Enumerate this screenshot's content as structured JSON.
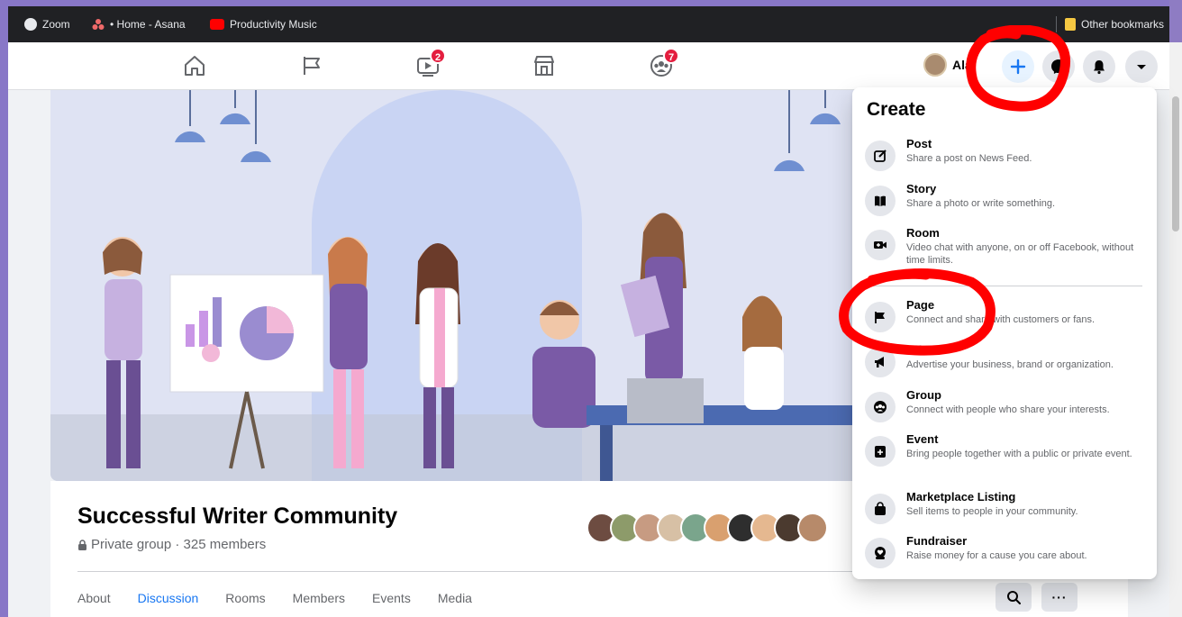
{
  "bookmarks": {
    "items": [
      {
        "label": "Zoom",
        "icon": "globe-icon"
      },
      {
        "label": "• Home - Asana",
        "icon": "asana-icon"
      },
      {
        "label": "Productivity Music",
        "icon": "youtube-icon"
      }
    ],
    "other": "Other bookmarks"
  },
  "nav": {
    "watch_badge": "2",
    "groups_badge": "7",
    "profile_name": "Ala",
    "colors": {
      "accent": "#1877f2",
      "badge": "#e41e3f"
    }
  },
  "group": {
    "name": "Successful Writer Community",
    "meta": "Private group · 325 members",
    "tabs": [
      "About",
      "Discussion",
      "Rooms",
      "Members",
      "Events",
      "Media"
    ],
    "active_tab": "Discussion"
  },
  "create_menu": {
    "title": "Create",
    "items": [
      {
        "label": "Post",
        "desc": "Share a post on News Feed.",
        "icon": "edit-icon"
      },
      {
        "label": "Story",
        "desc": "Share a photo or write something.",
        "icon": "book-icon"
      },
      {
        "label": "Room",
        "desc": "Video chat with anyone, on or off Facebook, without time limits.",
        "icon": "video-icon"
      },
      {
        "label": "Page",
        "desc": "Connect and share with customers or fans.",
        "icon": "flag-icon"
      },
      {
        "label": "Ad",
        "desc": "Advertise your business, brand or organization.",
        "icon": "megaphone-icon"
      },
      {
        "label": "Group",
        "desc": "Connect with people who share your interests.",
        "icon": "group-icon"
      },
      {
        "label": "Event",
        "desc": "Bring people together with a public or private event.",
        "icon": "calendar-icon"
      },
      {
        "label": "Marketplace Listing",
        "desc": "Sell items to people in your community.",
        "icon": "bag-icon"
      },
      {
        "label": "Fundraiser",
        "desc": "Raise money for a cause you care about.",
        "icon": "heart-hand-icon"
      }
    ]
  }
}
